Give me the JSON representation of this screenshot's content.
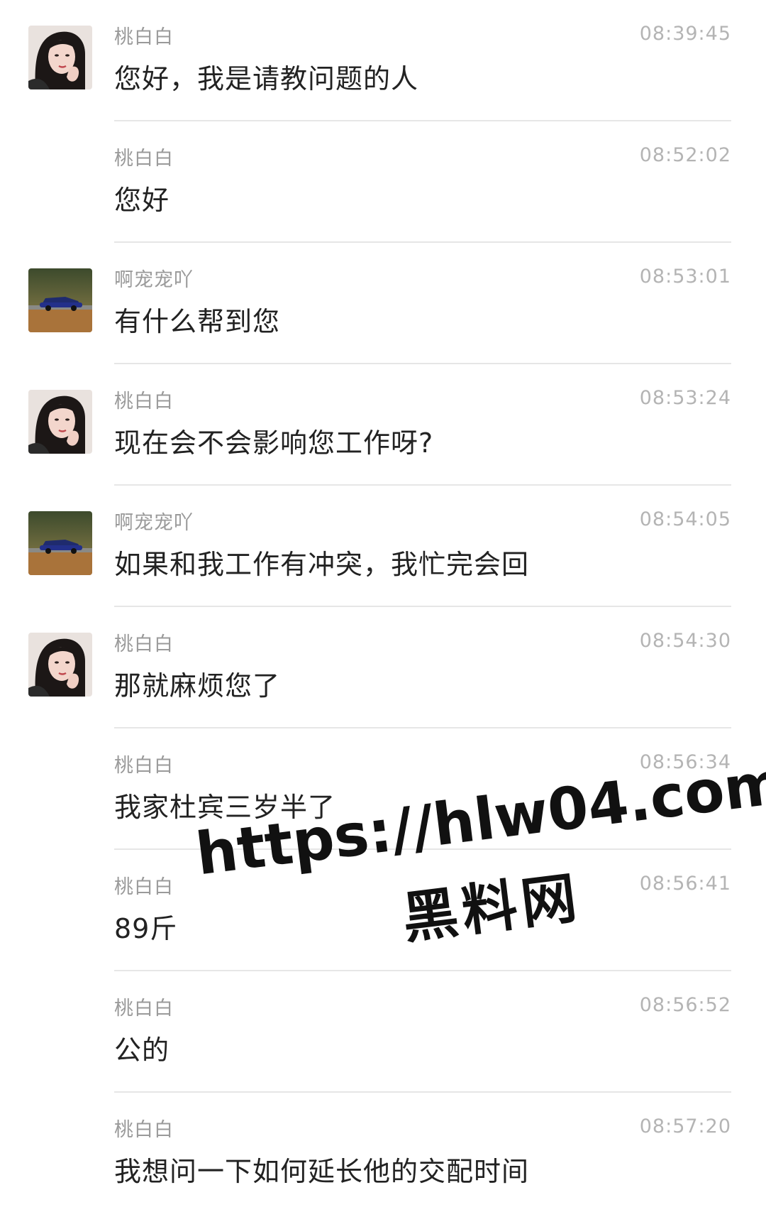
{
  "messages": [
    {
      "sender": "桃白白",
      "time": "08:39:45",
      "text": "您好，我是请教问题的人",
      "avatar": "woman-portrait"
    },
    {
      "sender": "桃白白",
      "time": "08:52:02",
      "text": "您好",
      "avatar": ""
    },
    {
      "sender": "啊宠宠吖",
      "time": "08:53:01",
      "text": "有什么帮到您",
      "avatar": "car-photo"
    },
    {
      "sender": "桃白白",
      "time": "08:53:24",
      "text": "现在会不会影响您工作呀?",
      "avatar": "woman-portrait"
    },
    {
      "sender": "啊宠宠吖",
      "time": "08:54:05",
      "text": "如果和我工作有冲突，我忙完会回",
      "avatar": "car-photo"
    },
    {
      "sender": "桃白白",
      "time": "08:54:30",
      "text": "那就麻烦您了",
      "avatar": "woman-portrait"
    },
    {
      "sender": "桃白白",
      "time": "08:56:34",
      "text": "我家杜宾三岁半了",
      "avatar": ""
    },
    {
      "sender": "桃白白",
      "time": "08:56:41",
      "text": "89斤",
      "avatar": ""
    },
    {
      "sender": "桃白白",
      "time": "08:56:52",
      "text": "公的",
      "avatar": ""
    },
    {
      "sender": "桃白白",
      "time": "08:57:20",
      "text": "我想问一下如何延长他的交配时间",
      "avatar": ""
    }
  ],
  "watermark": {
    "url": "https://hlw04.com",
    "label": "黑料网"
  }
}
